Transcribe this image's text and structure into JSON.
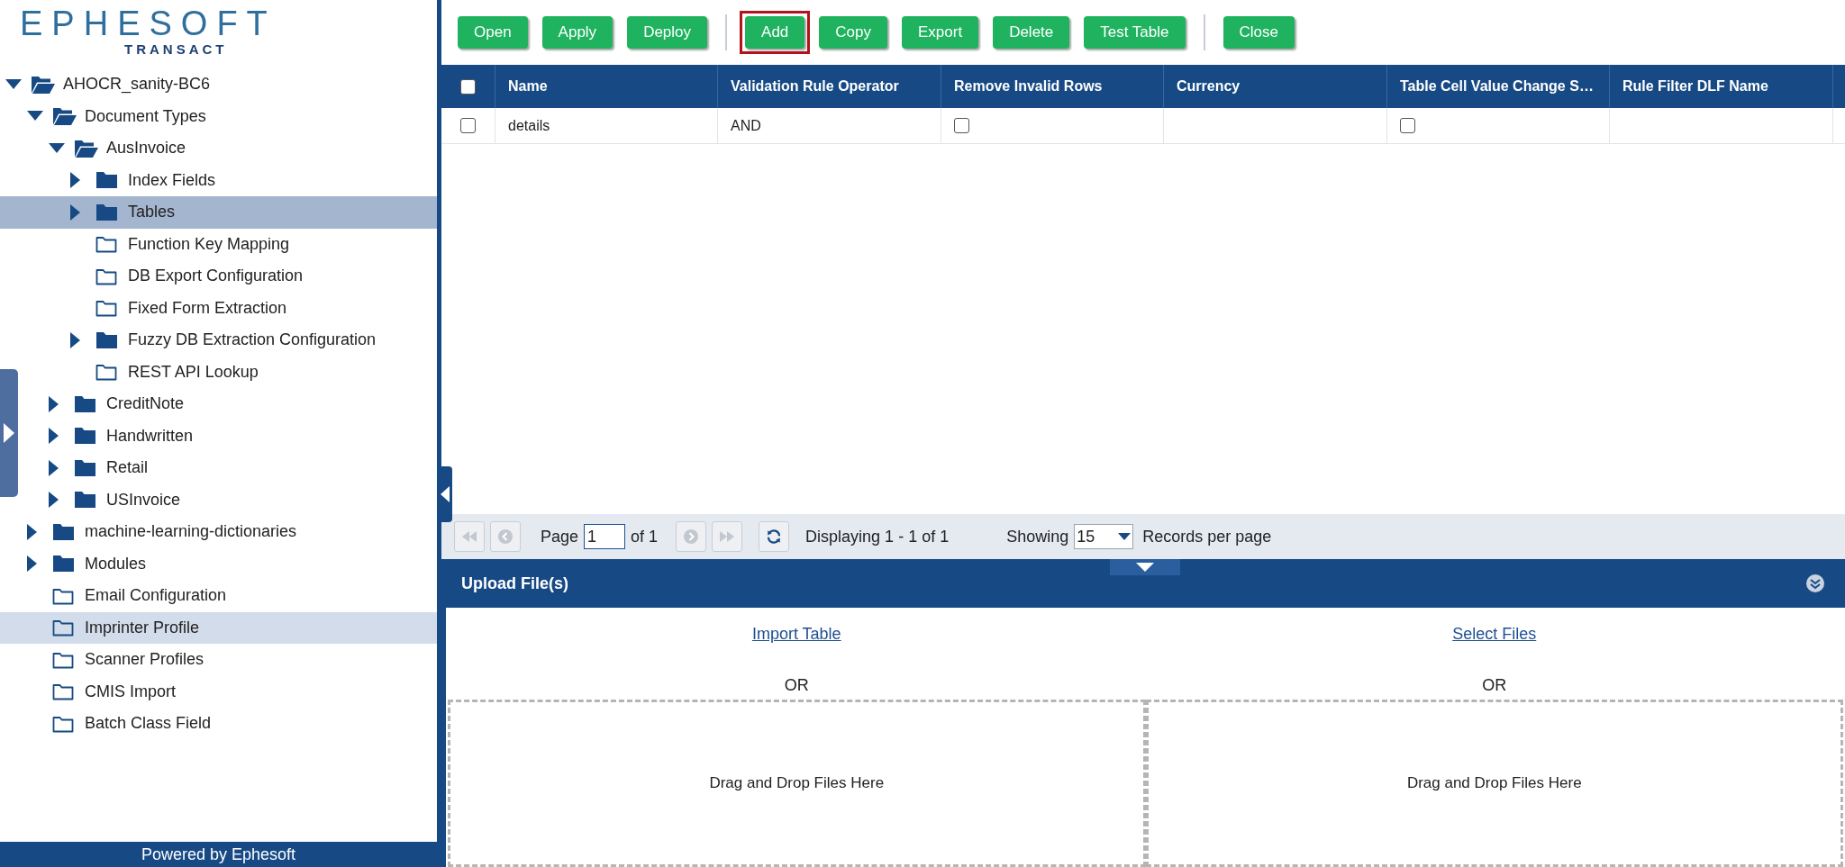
{
  "logo": {
    "name": "EPHESOFT",
    "product": "TRANSACT"
  },
  "tree": [
    {
      "label": "AHOCR_sanity-BC6",
      "kind": "branch",
      "expanded": true,
      "selected": false,
      "hovered": false,
      "children": [
        {
          "label": "Document Types",
          "kind": "branch",
          "expanded": true,
          "selected": false,
          "hovered": false,
          "children": [
            {
              "label": "AusInvoice",
              "kind": "branch",
              "expanded": true,
              "selected": false,
              "hovered": false,
              "children": [
                {
                  "label": "Index Fields",
                  "kind": "branch",
                  "expanded": false,
                  "selected": false,
                  "hovered": false
                },
                {
                  "label": "Tables",
                  "kind": "branch",
                  "expanded": false,
                  "selected": true,
                  "hovered": false
                },
                {
                  "label": "Function Key Mapping",
                  "kind": "leaf",
                  "selected": false,
                  "hovered": false
                },
                {
                  "label": "DB Export Configuration",
                  "kind": "leaf",
                  "selected": false,
                  "hovered": false
                },
                {
                  "label": "Fixed Form Extraction",
                  "kind": "leaf",
                  "selected": false,
                  "hovered": false
                },
                {
                  "label": "Fuzzy DB Extraction Configuration",
                  "kind": "branch",
                  "expanded": false,
                  "selected": false,
                  "hovered": false
                },
                {
                  "label": "REST API Lookup",
                  "kind": "leaf",
                  "selected": false,
                  "hovered": false
                }
              ]
            },
            {
              "label": "CreditNote",
              "kind": "branch",
              "expanded": false,
              "selected": false,
              "hovered": false
            },
            {
              "label": "Handwritten",
              "kind": "branch",
              "expanded": false,
              "selected": false,
              "hovered": false
            },
            {
              "label": "Retail",
              "kind": "branch",
              "expanded": false,
              "selected": false,
              "hovered": false
            },
            {
              "label": "USInvoice",
              "kind": "branch",
              "expanded": false,
              "selected": false,
              "hovered": false
            }
          ]
        },
        {
          "label": "machine-learning-dictionaries",
          "kind": "branch",
          "expanded": false,
          "selected": false,
          "hovered": false
        },
        {
          "label": "Modules",
          "kind": "branch",
          "expanded": false,
          "selected": false,
          "hovered": false
        },
        {
          "label": "Email Configuration",
          "kind": "leaf",
          "selected": false,
          "hovered": false
        },
        {
          "label": "Imprinter Profile",
          "kind": "leaf",
          "selected": false,
          "hovered": true
        },
        {
          "label": "Scanner Profiles",
          "kind": "leaf",
          "selected": false,
          "hovered": false
        },
        {
          "label": "CMIS Import",
          "kind": "leaf",
          "selected": false,
          "hovered": false
        },
        {
          "label": "Batch Class Field",
          "kind": "leaf",
          "selected": false,
          "hovered": false
        }
      ]
    }
  ],
  "footer": "Powered by Ephesoft",
  "toolbar": [
    [
      {
        "label": "Open",
        "outlined": false
      },
      {
        "label": "Apply",
        "outlined": false
      },
      {
        "label": "Deploy",
        "outlined": false
      }
    ],
    [
      {
        "label": "Add",
        "outlined": true
      },
      {
        "label": "Copy",
        "outlined": false
      },
      {
        "label": "Export",
        "outlined": false
      },
      {
        "label": "Delete",
        "outlined": false
      },
      {
        "label": "Test Table",
        "outlined": false
      }
    ],
    [
      {
        "label": "Close",
        "outlined": false
      }
    ]
  ],
  "table": {
    "header_checked": false,
    "columns": [
      "Name",
      "Validation Rule Operator",
      "Remove Invalid Rows",
      "Currency",
      "Table Cell Value Change S…",
      "Rule Filter DLF Name"
    ],
    "rows": [
      {
        "checked": false,
        "cells": [
          {
            "kind": "text",
            "text": "details"
          },
          {
            "kind": "text",
            "text": "AND"
          },
          {
            "kind": "checkbox",
            "checked": false
          },
          {
            "kind": "empty"
          },
          {
            "kind": "checkbox",
            "checked": false
          },
          {
            "kind": "empty"
          }
        ]
      }
    ]
  },
  "pager": {
    "page_label": "Page",
    "page": "1",
    "of": "of 1",
    "displaying": "Displaying 1 - 1 of 1",
    "showing": "Showing",
    "per_page": "15",
    "records": "Records per page"
  },
  "upload": {
    "title": "Upload File(s)",
    "panels": [
      {
        "link": "Import Table",
        "or": "OR",
        "drop": "Drag and Drop Files Here"
      },
      {
        "link": "Select Files",
        "or": "OR",
        "drop": "Drag and Drop Files Here"
      }
    ]
  }
}
